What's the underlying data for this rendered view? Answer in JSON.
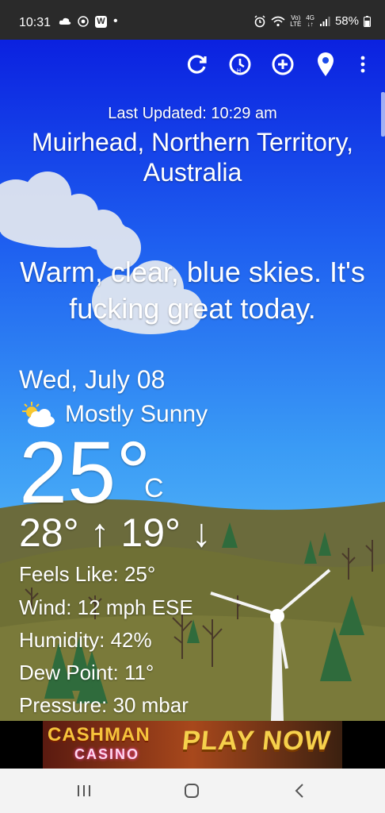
{
  "status_bar": {
    "time": "10:31",
    "app_badge": "W",
    "net_top": "Vo)",
    "net_bottom": "LTE",
    "gen_top": "4G",
    "gen_bottom": "↓↑",
    "battery": "58%"
  },
  "toolbar": {
    "icons": [
      "refresh-icon",
      "history-clock-icon",
      "add-icon",
      "location-pin-icon",
      "more-vert-icon"
    ]
  },
  "weather": {
    "last_updated": "Last Updated: 10:29 am",
    "location": "Muirhead, Northern Territory, Australia",
    "quote": "Warm, clear, blue skies. It's fucking great today.",
    "date": "Wed, July 08",
    "condition": "Mostly Sunny",
    "temperature": "25°",
    "unit": "C",
    "high_low": "28° ↑ 19° ↓",
    "feels_like": "Feels Like: 25°",
    "wind": "Wind: 12 mph ESE",
    "humidity": "Humidity: 42%",
    "dew_point": "Dew Point: 11°",
    "pressure": "Pressure: 30 mbar"
  },
  "ad": {
    "brand": "CASHMAN",
    "sub": "CASINO",
    "cta": "PLAY NOW"
  },
  "nav": {
    "icons": [
      "recent-apps-icon",
      "home-icon",
      "back-icon"
    ]
  }
}
